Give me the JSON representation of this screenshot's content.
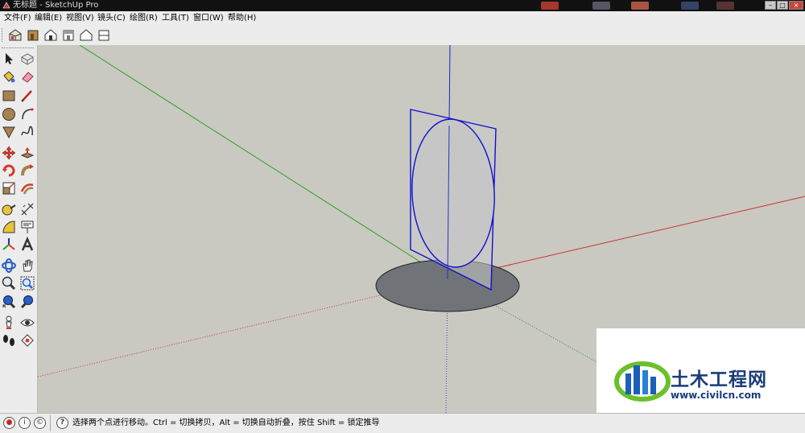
{
  "window": {
    "title": "无标题 - SketchUp Pro",
    "controls": [
      "minimize",
      "maximize",
      "close"
    ]
  },
  "menu": {
    "items": [
      "文件(F)",
      "编辑(E)",
      "视图(V)",
      "镜头(C)",
      "绘图(R)",
      "工具(T)",
      "窗口(W)",
      "帮助(H)"
    ]
  },
  "views_toolbar": {
    "buttons": [
      "iso-view-icon",
      "front-view-icon",
      "right-view-icon",
      "back-view-icon",
      "top-view-icon",
      "left-view-icon"
    ]
  },
  "tools": [
    "select-icon",
    "component-icon",
    "paint-bucket-icon",
    "eraser-icon",
    "rectangle-icon",
    "line-icon",
    "circle-icon",
    "arc-icon",
    "polygon-icon",
    "freehand-icon",
    "move-icon",
    "push-pull-icon",
    "rotate-icon",
    "follow-me-icon",
    "scale-icon",
    "offset-icon",
    "tape-measure-icon",
    "dimension-icon",
    "protractor-icon",
    "text-icon",
    "axes-icon",
    "3d-text-icon",
    "orbit-icon",
    "pan-icon",
    "zoom-icon",
    "zoom-window-icon",
    "zoom-extents-icon",
    "previous-view-icon",
    "position-camera-icon",
    "look-around-icon",
    "walk-icon",
    "section-plane-icon"
  ],
  "status": {
    "icons": [
      "geo-location-icon",
      "credits-icon",
      "copyright-icon",
      "help-icon"
    ],
    "message": "选择两个点进行移动。Ctrl = 切换拷贝，Alt = 切换自动折叠，按住 Shift = 锁定推导"
  },
  "watermark": {
    "name": "土木工程网",
    "url": "www.civilcn.com"
  },
  "colors": {
    "viewport_bg": "#c9c9c1",
    "selection_blue": "#1010cc",
    "axis_red": "#c83232",
    "axis_green": "#22a022",
    "axis_blue": "#2020c8",
    "disc_fill": "#707478",
    "brand_blue": "#1b3d7a"
  }
}
